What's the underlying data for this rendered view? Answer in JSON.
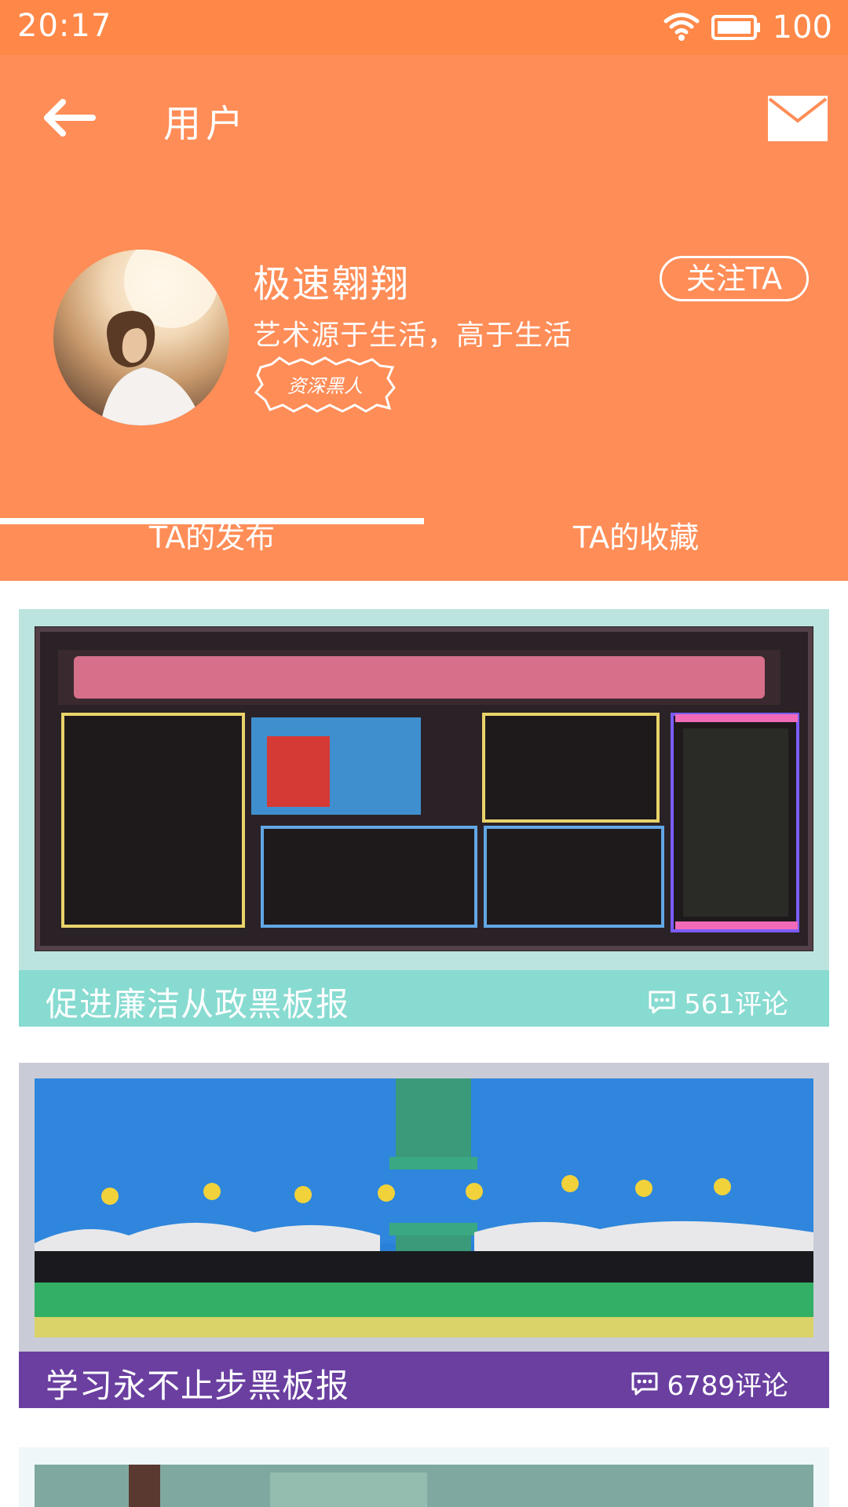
{
  "status_bar": {
    "time": "20:17",
    "battery": "100"
  },
  "header": {
    "title": "用户",
    "back_icon": "back-arrow-icon",
    "mail_icon": "mail-icon",
    "background": "#FF8D57"
  },
  "profile": {
    "username": "极速翱翔",
    "bio": "艺术源于生活，高于生活",
    "badge": "资深黑人",
    "follow_label": "关注TA"
  },
  "tabs": [
    {
      "label": "TA的发布",
      "active": true
    },
    {
      "label": "TA的收藏",
      "active": false
    }
  ],
  "posts": [
    {
      "title": "促进廉洁从政黑板报",
      "comments": "561评论",
      "bar_color": "#88DBD1",
      "frame_color": "#BCE4DE"
    },
    {
      "title": "学习永不止步黑板报",
      "comments": "6789评论",
      "bar_color": "#6A3FA0",
      "frame_color": "#C9CCD6"
    }
  ]
}
